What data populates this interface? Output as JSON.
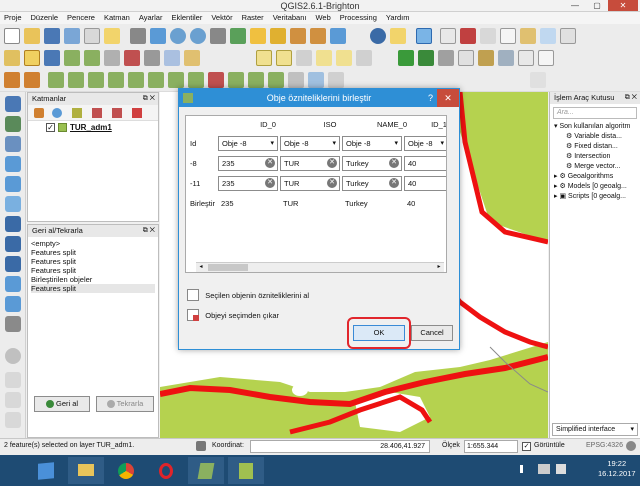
{
  "window": {
    "title": "QGIS2.6.1-Brighton",
    "controls": [
      "—",
      "▢",
      "✕"
    ]
  },
  "menu": [
    "Proje",
    "Düzenle",
    "Pencere",
    "Katman",
    "Ayarlar",
    "Eklentiler",
    "Vektör",
    "Raster",
    "Veritabanı",
    "Web",
    "Processing",
    "Yardım"
  ],
  "layers_panel": {
    "title": "Katmanlar",
    "layer_name": "TUR_adm1"
  },
  "undo_panel": {
    "title": "Geri al/Tekrarla",
    "items": [
      "<empty>",
      "Features split",
      "Features split",
      "Features split",
      "Birleştirilen objeler",
      "Features split"
    ],
    "undo_label": "Geri al",
    "redo_label": "Tekrarla"
  },
  "processing_panel": {
    "title": "İşlem Araç Kutusu",
    "search_placeholder": "Ara...",
    "recent_label": "Son kullanılan algoritm",
    "recent_items": [
      "Variable dista...",
      "Fixed distan...",
      "Intersection",
      "Merge vector..."
    ],
    "groups": [
      "Geoalgorithms",
      "Models [0 geoalg...",
      "Scripts [0 geoalg..."
    ],
    "interface_option": "Simplified interface"
  },
  "dialog": {
    "title": "Obje özniteliklerini birleştir",
    "help": "?",
    "close": "✕",
    "columns": [
      "ID_0",
      "ISO",
      "NAME_0",
      "ID_1"
    ],
    "row_labels": [
      "Id",
      "-8",
      "-11",
      "Birleştir"
    ],
    "combo_value": "Obje -8",
    "rows": [
      [
        "235",
        "TUR",
        "Turkey",
        "40"
      ],
      [
        "235",
        "TUR",
        "Turkey",
        "40"
      ]
    ],
    "merged": [
      "235",
      "TUR",
      "Turkey",
      "40"
    ],
    "action_select_label": "Seçilen objenin özniteliklerini al",
    "action_remove_label": "Objeyi seçimden çıkar",
    "ok_label": "OK",
    "cancel_label": "Cancel"
  },
  "statusbar": {
    "message": "2 feature(s) selected on layer TUR_adm1.",
    "coord_label": "Koordinat:",
    "coord_value": "28.406,41.927",
    "scale_label": "Ölçek",
    "scale_value": "1:655.344",
    "render_label": "Görüntüle",
    "epsg": "EPSG:4326"
  },
  "taskbar": {
    "time": "19:22",
    "date": "16.12.2017"
  },
  "colors": {
    "accent": "#2e8fd6",
    "land": "#b5d24f",
    "border": "#ee1111",
    "ok_highlight": "#e1262c"
  }
}
